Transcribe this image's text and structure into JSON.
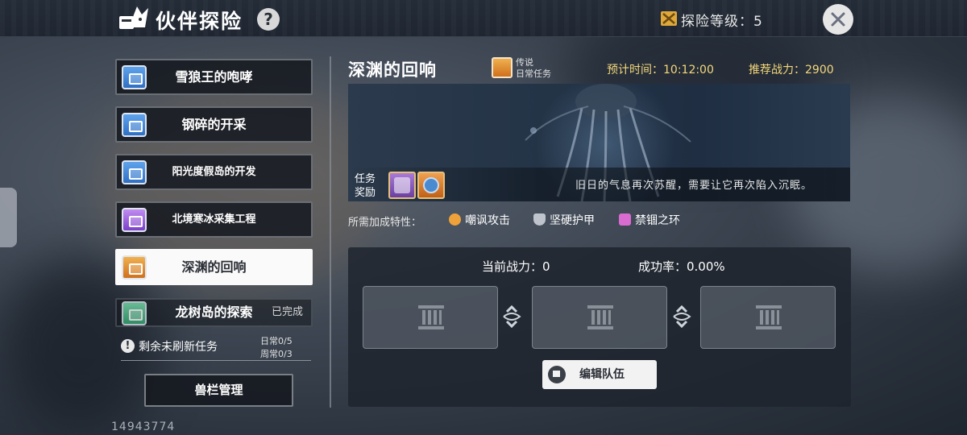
{
  "header": {
    "title": "伙伴探险",
    "help": "?",
    "level_label": "探险等级：5",
    "close_icon": "close-icon"
  },
  "quests": [
    {
      "label": "雪狼王的咆哮",
      "color": "#3f87d8",
      "state": "normal"
    },
    {
      "label": "钢碎的开采",
      "color": "#3f87d8",
      "state": "normal"
    },
    {
      "label": "阳光度假岛的开发",
      "color": "#3f87d8",
      "state": "normal"
    },
    {
      "label": "北境寒冰采集工程",
      "color": "#9a5ad8",
      "state": "normal"
    },
    {
      "label": "深渊的回响",
      "color": "#e08a30",
      "state": "selected"
    },
    {
      "label": "龙树岛的探索",
      "color": "#4cc08a",
      "state": "done",
      "status": "已完成"
    }
  ],
  "refresh": {
    "label": "剩余未刷新任务",
    "daily": "日常0/5",
    "weekly": "周常0/3"
  },
  "pen_button": "兽栏管理",
  "uid": "14943774",
  "detail": {
    "title": "深渊的回响",
    "type_line1": "传说",
    "type_line2": "日常任务",
    "time": "预计时间：10:12:00",
    "power": "推荐战力：2900",
    "reward_label_1": "任务",
    "reward_label_2": "奖励",
    "description": "旧日的气息再次苏醒，需要让它再次陷入沉眠。",
    "traits_label": "所需加成特性：",
    "traits": [
      "嘲讽攻击",
      "坚硬护甲",
      "禁锢之环"
    ],
    "current_power": "当前战力：0",
    "success_rate": "成功率：0.00%",
    "edit_team": "编辑队伍"
  },
  "colors": {
    "accent_gold": "#f5d87a",
    "selected_bg": "#fafafa"
  }
}
